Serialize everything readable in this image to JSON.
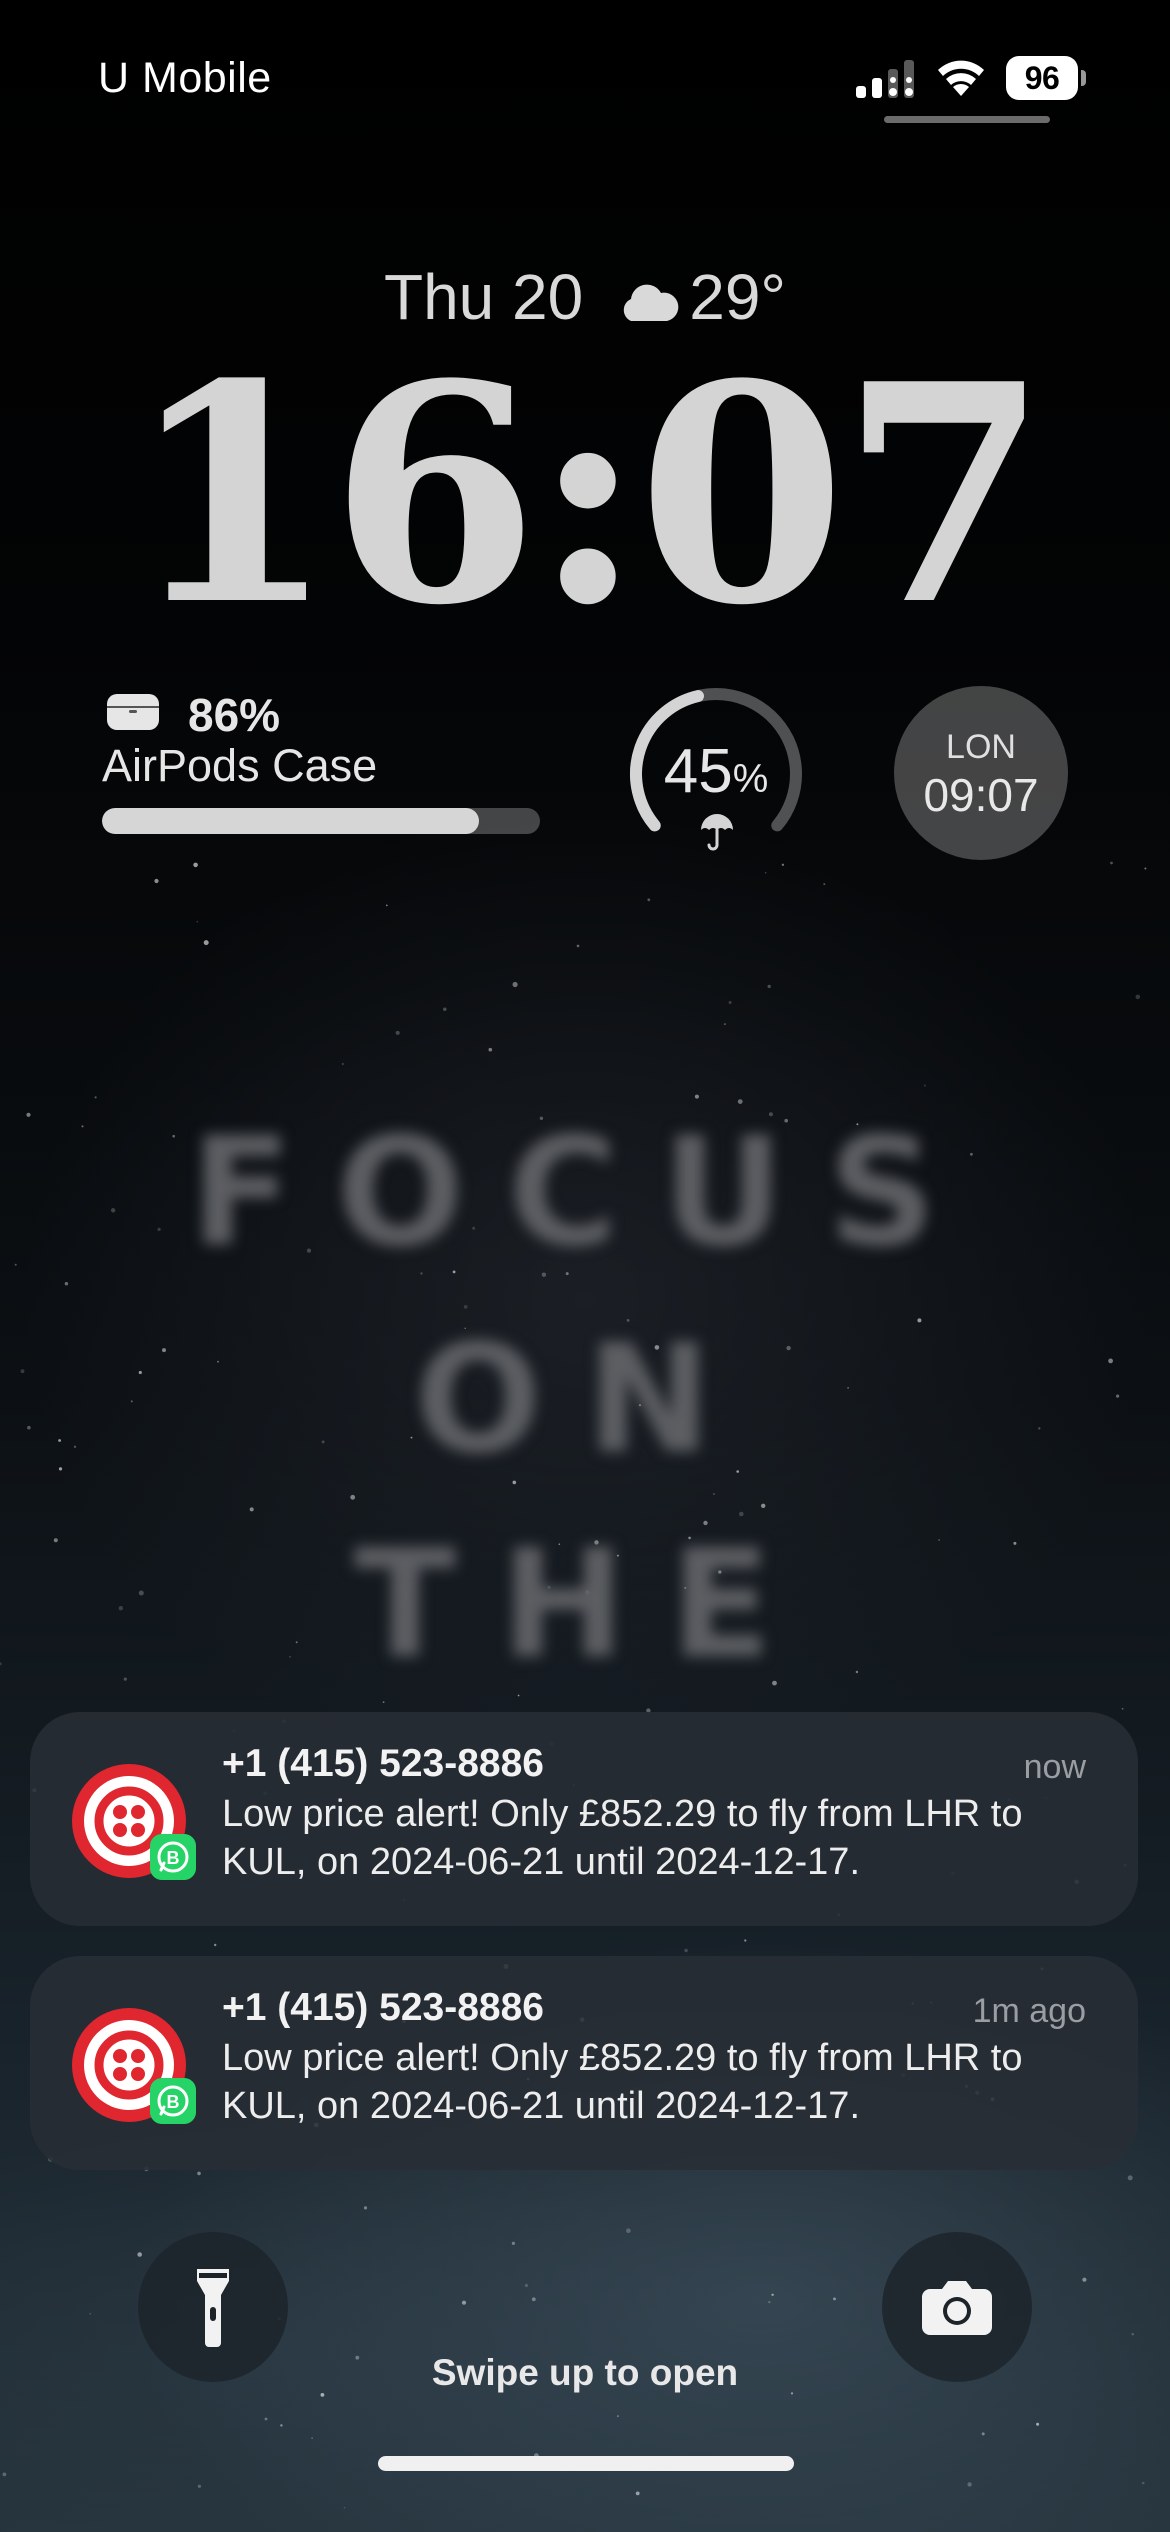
{
  "status_bar": {
    "carrier": "U Mobile",
    "battery_level": "96",
    "icons": [
      "cellular-signal-icon",
      "wifi-icon",
      "battery-icon"
    ]
  },
  "date_weather": {
    "date": "Thu 20",
    "weather_icon": "cloud-icon",
    "temperature": "29°"
  },
  "clock": {
    "time": "16:07"
  },
  "widgets": {
    "airpods": {
      "icon": "airpods-case-icon",
      "percent": "86%",
      "level_fraction": 0.86,
      "label": "AirPods Case"
    },
    "rain_chance": {
      "value": "45",
      "unit": "%",
      "level_fraction": 0.45,
      "icon": "umbrella-icon"
    },
    "world_clock": {
      "city": "LON",
      "time": "09:07"
    }
  },
  "wallpaper_text": [
    "FOCUS",
    "ON",
    "THE"
  ],
  "notifications": [
    {
      "app_icon": "twilio-icon",
      "badge_icon": "whatsapp-business-icon",
      "sender": "+1 (415) 523-8886",
      "time": "now",
      "body": "Low price alert! Only £852.29 to fly from LHR to KUL, on 2024-06-21 until 2024-12-17."
    },
    {
      "app_icon": "twilio-icon",
      "badge_icon": "whatsapp-business-icon",
      "sender": "+1 (415) 523-8886",
      "time": "1m ago",
      "body": "Low price alert! Only £852.29 to fly from LHR to KUL, on 2024-06-21 until 2024-12-17."
    }
  ],
  "bottom": {
    "flashlight_icon": "flashlight-icon",
    "camera_icon": "camera-icon",
    "swipe_hint": "Swipe up to open"
  },
  "colors": {
    "twilio_red": "#e0262f",
    "whatsapp_green": "#25d366"
  }
}
